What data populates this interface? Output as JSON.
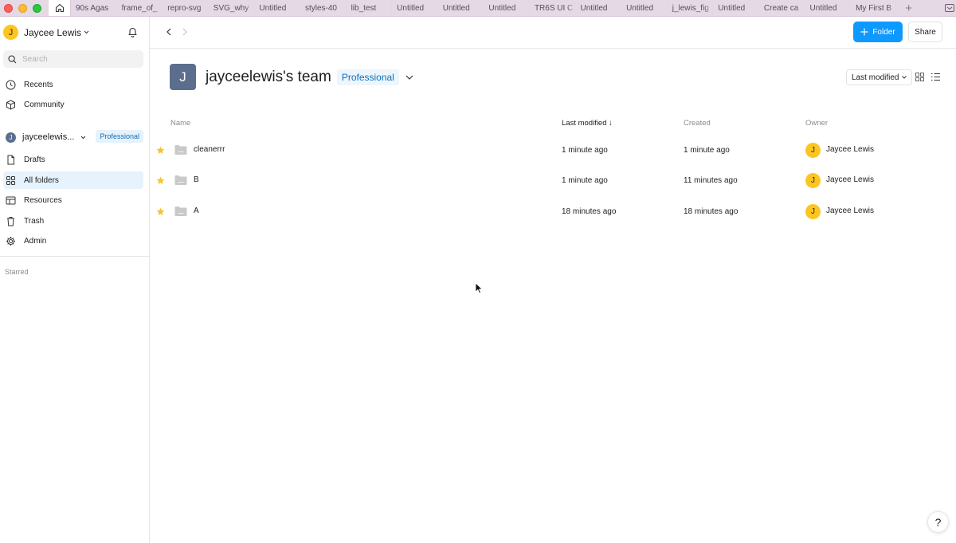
{
  "tabs": [
    "90s Agas",
    "frame_of_",
    "repro-svg",
    "SVG_why",
    "Untitled",
    "styles-40",
    "lib_test",
    "Untitled",
    "Untitled",
    "Untitled",
    "TR6S UI C",
    "Untitled",
    "Untitled",
    "j_lewis_fig",
    "Untitled",
    "Create ca",
    "Untitled",
    "My First B"
  ],
  "new_tab": "+",
  "sidebar": {
    "user_name": "Jaycee Lewis",
    "user_initial": "J",
    "search_placeholder": "Search",
    "recents": "Recents",
    "community": "Community",
    "team_name": "jayceelewis...",
    "team_initial": "J",
    "team_plan": "Professional",
    "drafts": "Drafts",
    "all_folders": "All folders",
    "resources": "Resources",
    "trash": "Trash",
    "admin": "Admin",
    "starred": "Starred"
  },
  "toolbar": {
    "folder_label": "Folder",
    "share_label": "Share"
  },
  "header": {
    "team_initial": "J",
    "team_title": "jayceelewis's team",
    "plan": "Professional",
    "sort_label": "Last modified"
  },
  "table": {
    "columns": {
      "name": "Name",
      "last_modified": "Last modified ↓",
      "created": "Created",
      "owner": "Owner"
    },
    "rows": [
      {
        "name": "cleanerrr",
        "last_modified": "1 minute ago",
        "created": "1 minute ago",
        "owner": "Jaycee Lewis",
        "owner_initial": "J"
      },
      {
        "name": "B",
        "last_modified": "1 minute ago",
        "created": "11 minutes ago",
        "owner": "Jaycee Lewis",
        "owner_initial": "J"
      },
      {
        "name": "A",
        "last_modified": "18 minutes ago",
        "created": "18 minutes ago",
        "owner": "Jaycee Lewis",
        "owner_initial": "J"
      }
    ]
  },
  "help_label": "?",
  "colors": {
    "accent": "#0d99ff",
    "avatar": "#fcc521",
    "team": "#5c6e8e",
    "tabbar": "#e6d9e6",
    "star": "#f5c431"
  }
}
